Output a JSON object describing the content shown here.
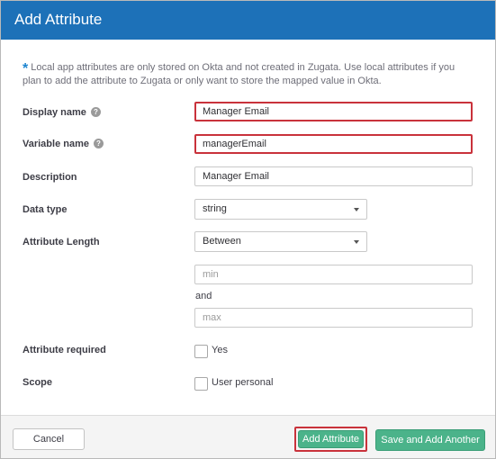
{
  "dialog": {
    "title": "Add Attribute",
    "info_icon": "asterisk-icon",
    "info_text": "Local app attributes are only stored on Okta and not created in Zugata. Use local attributes if you plan to add the attribute to Zugata or only want to store the mapped value in Okta."
  },
  "fields": {
    "display_name": {
      "label": "Display name",
      "value": "Manager Email"
    },
    "variable_name": {
      "label": "Variable name",
      "value": "managerEmail"
    },
    "description": {
      "label": "Description",
      "value": "Manager Email"
    },
    "data_type": {
      "label": "Data type",
      "value": "string"
    },
    "attribute_length": {
      "label": "Attribute Length",
      "value": "Between",
      "min_placeholder": "min",
      "and_text": "and",
      "max_placeholder": "max"
    },
    "attribute_required": {
      "label": "Attribute required",
      "option": "Yes"
    },
    "scope": {
      "label": "Scope",
      "option": "User personal"
    }
  },
  "help_icon": "?",
  "footer": {
    "cancel_label": "Cancel",
    "add_label": "Add Attribute",
    "save_add_another_label": "Save and Add Another"
  },
  "colors": {
    "header": "#1d71b8",
    "highlight": "#c9323b",
    "primary_button": "#4bb38a"
  }
}
